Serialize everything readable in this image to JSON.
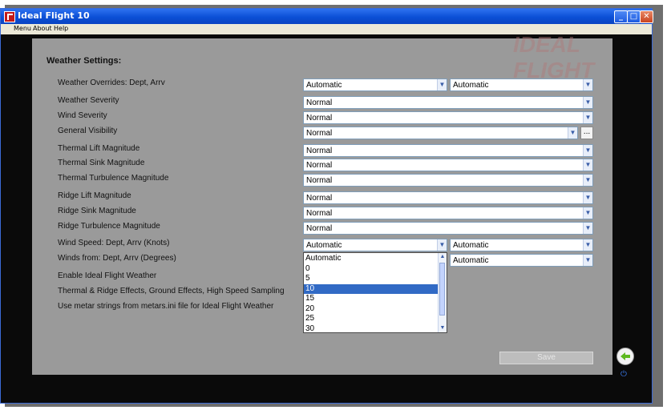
{
  "window": {
    "title": "Ideal Flight 10",
    "controls": {
      "minimize": "_",
      "maximize": "□",
      "close": "✕"
    }
  },
  "menubar": {
    "items": [
      "Menu",
      "About",
      "Help"
    ]
  },
  "watermark": "IDEAL FLIGHT",
  "settings": {
    "heading": "Weather Settings:",
    "rows": [
      {
        "label": "Weather Overrides: Dept, Arrv",
        "value1": "Automatic",
        "value2": "Automatic"
      },
      {
        "label": "Weather Severity",
        "value1": "Normal"
      },
      {
        "label": "Wind Severity",
        "value1": "Normal"
      },
      {
        "label": "General Visibility",
        "value1": "Normal",
        "button": "..."
      },
      {
        "label": "Thermal Lift Magnitude",
        "value1": "Normal"
      },
      {
        "label": "Thermal Sink Magnitude",
        "value1": "Normal"
      },
      {
        "label": "Thermal Turbulence Magnitude",
        "value1": "Normal"
      },
      {
        "label": "Ridge Lift Magnitude",
        "value1": "Normal"
      },
      {
        "label": "Ridge Sink Magnitude",
        "value1": "Normal"
      },
      {
        "label": "Ridge Turbulence Magnitude",
        "value1": "Normal"
      },
      {
        "label": "Wind Speed: Dept, Arrv (Knots)",
        "value1": "Automatic",
        "value2": "Automatic"
      },
      {
        "label": "Winds from: Dept, Arrv (Degrees)",
        "value2": "Automatic"
      },
      {
        "label": "Enable Ideal Flight Weather"
      },
      {
        "label": "Thermal & Ridge Effects, Ground Effects, High Speed Sampling"
      },
      {
        "label": "Use metar strings from metars.ini file for Ideal Flight Weather"
      }
    ]
  },
  "wind_speed_dropdown": {
    "options": [
      "Automatic",
      "0",
      "5",
      "10",
      "15",
      "20",
      "25",
      "30"
    ],
    "selected": "10"
  },
  "footer": {
    "save_label": "Save"
  },
  "icons": {
    "back": "back-arrow-icon",
    "power": "power-icon"
  },
  "colors": {
    "titlebar": "#0b4fd6",
    "selection": "#316ac5",
    "panel": "#9a9a9a"
  }
}
